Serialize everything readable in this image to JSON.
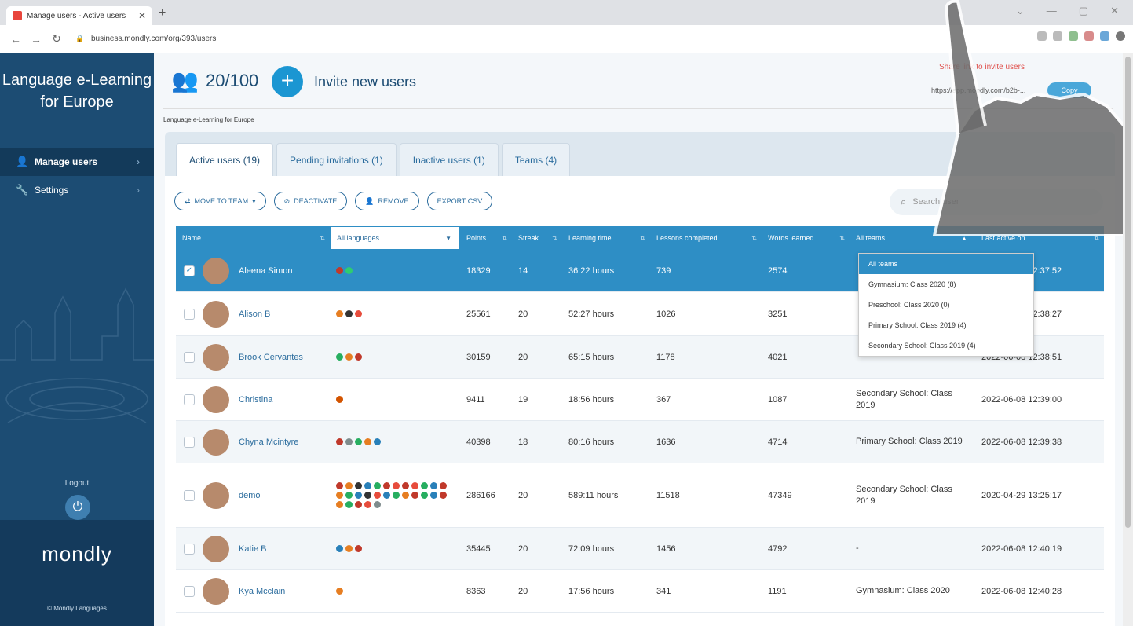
{
  "browser": {
    "tab_title": "Manage users - Active users",
    "url": "business.mondly.com/org/393/users",
    "win_controls": [
      "⌄",
      "—",
      "▢",
      "✕"
    ]
  },
  "sidebar": {
    "brand": "Language e-Learning for Europe",
    "items": [
      {
        "label": "Manage users",
        "icon": "user-icon"
      },
      {
        "label": "Settings",
        "icon": "wrench-icon"
      }
    ],
    "logout_label": "Logout",
    "logo": "mondly",
    "copyright": "© Mondly Languages"
  },
  "header": {
    "user_count": "20/100",
    "invite_label": "Invite new users",
    "org_name": "Language e-Learning for Europe",
    "share_title": "Share link to invite users",
    "share_link": "https://app.mondly.com/b2b-...",
    "copy_label": "Copy"
  },
  "tabs": [
    {
      "label": "Active users (19)"
    },
    {
      "label": "Pending invitations (1)"
    },
    {
      "label": "Inactive users (1)"
    },
    {
      "label": "Teams (4)"
    }
  ],
  "actions": [
    {
      "label": "MOVE TO TEAM",
      "icon": "move-icon"
    },
    {
      "label": "DEACTIVATE",
      "icon": "deactivate-icon"
    },
    {
      "label": "REMOVE",
      "icon": "remove-user-icon"
    },
    {
      "label": "EXPORT CSV",
      "icon": ""
    }
  ],
  "search": {
    "placeholder": "Search user"
  },
  "table": {
    "columns": [
      "Name",
      "All languages",
      "Points",
      "Streak",
      "Learning time",
      "Lessons completed",
      "Words learned",
      "All teams",
      "Last active on"
    ],
    "rows": [
      {
        "name": "Aleena Simon",
        "points": "18329",
        "streak": "14",
        "time": "36:22 hours",
        "lessons": "739",
        "words": "2574",
        "team": "",
        "last": "2022-06-08 12:37:52",
        "selected": true,
        "flags": [
          "#c0392b",
          "#2ecc71"
        ]
      },
      {
        "name": "Alison B",
        "points": "25561",
        "streak": "20",
        "time": "52:27 hours",
        "lessons": "1026",
        "words": "3251",
        "team": "",
        "last": "2022-06-08 12:38:27",
        "flags": [
          "#e67e22",
          "#333333",
          "#e74c3c"
        ]
      },
      {
        "name": "Brook Cervantes",
        "points": "30159",
        "streak": "20",
        "time": "65:15 hours",
        "lessons": "1178",
        "words": "4021",
        "team": "",
        "last": "2022-06-08 12:38:51",
        "flags": [
          "#27ae60",
          "#e67e22",
          "#c0392b"
        ]
      },
      {
        "name": "Christina",
        "points": "9411",
        "streak": "19",
        "time": "18:56 hours",
        "lessons": "367",
        "words": "1087",
        "team": "Secondary School: Class 2019",
        "last": "2022-06-08 12:39:00",
        "flags": [
          "#d35400"
        ]
      },
      {
        "name": "Chyna Mcintyre",
        "points": "40398",
        "streak": "18",
        "time": "80:16 hours",
        "lessons": "1636",
        "words": "4714",
        "team": "Primary School: Class 2019",
        "last": "2022-06-08 12:39:38",
        "flags": [
          "#c0392b",
          "#7f8c8d",
          "#27ae60",
          "#e67e22",
          "#2980b9"
        ]
      },
      {
        "name": "demo",
        "points": "286166",
        "streak": "20",
        "time": "589:11 hours",
        "lessons": "11518",
        "words": "47349",
        "team": "Secondary School: Class 2019",
        "last": "2020-04-29 13:25:17",
        "flags": [
          "#c0392b",
          "#e67e22",
          "#333333",
          "#2980b9",
          "#27ae60",
          "#c0392b",
          "#e74c3c",
          "#c0392b",
          "#e74c3c",
          "#27ae60",
          "#2980b9",
          "#c0392b",
          "#e67e22",
          "#27ae60",
          "#2980b9",
          "#333333",
          "#e74c3c",
          "#2980b9",
          "#27ae60",
          "#e67e22",
          "#c0392b",
          "#27ae60",
          "#2980b9",
          "#c0392b",
          "#e67e22",
          "#27ae60",
          "#c0392b",
          "#e74c3c",
          "#7f8c8d"
        ]
      },
      {
        "name": "Katie B",
        "points": "35445",
        "streak": "20",
        "time": "72:09 hours",
        "lessons": "1456",
        "words": "4792",
        "team": "-",
        "last": "2022-06-08 12:40:19",
        "flags": [
          "#2980b9",
          "#e67e22",
          "#c0392b"
        ]
      },
      {
        "name": "Kya Mcclain",
        "points": "8363",
        "streak": "20",
        "time": "17:56 hours",
        "lessons": "341",
        "words": "1191",
        "team": "Gymnasium: Class 2020",
        "last": "2022-06-08 12:40:28",
        "flags": [
          "#e67e22"
        ]
      }
    ]
  },
  "teams_dropdown": [
    "All teams",
    "Gymnasium: Class 2020 (8)",
    "Preschool: Class 2020 (0)",
    "Primary School: Class 2019 (4)",
    "Secondary School: Class 2019 (4)"
  ]
}
